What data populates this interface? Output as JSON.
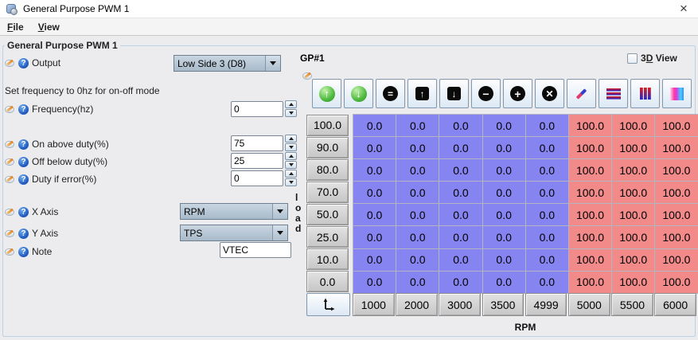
{
  "window": {
    "title": "General Purpose PWM 1",
    "close_glyph": "×"
  },
  "menu": {
    "items": [
      {
        "name": "file",
        "accel": "F",
        "rest": "ile"
      },
      {
        "name": "view",
        "accel": "V",
        "rest": "iew"
      }
    ]
  },
  "group": {
    "title": "General Purpose PWM 1"
  },
  "fields": {
    "output": {
      "label": "Output",
      "value": "Low Side 3 (D8)"
    },
    "hint": "Set frequency to 0hz for on-off mode",
    "frequency": {
      "label": "Frequency(hz)",
      "value": "0"
    },
    "on_above_duty": {
      "label": "On above duty(%)",
      "value": "75"
    },
    "off_below_duty": {
      "label": "Off below duty(%)",
      "value": "25"
    },
    "duty_if_error": {
      "label": "Duty if error(%)",
      "value": "0"
    },
    "x_axis": {
      "label": "X Axis",
      "value": "RPM"
    },
    "y_axis": {
      "label": "Y Axis",
      "value": "TPS"
    },
    "note": {
      "label": "Note",
      "value": "VTEC"
    }
  },
  "table": {
    "title": "GP#1",
    "view3d": {
      "prefix": "3",
      "accel": "D",
      "suffix": " View",
      "checked": false
    },
    "y_axis_label": "load",
    "x_axis_label": "RPM",
    "row_headers": [
      "100.0",
      "90.0",
      "80.0",
      "70.0",
      "50.0",
      "25.0",
      "10.0",
      "0.0"
    ],
    "col_headers": [
      "1000",
      "2000",
      "3000",
      "3500",
      "4999",
      "5000",
      "5500",
      "6000"
    ],
    "grid": [
      [
        "0.0",
        "0.0",
        "0.0",
        "0.0",
        "0.0",
        "100.0",
        "100.0",
        "100.0"
      ],
      [
        "0.0",
        "0.0",
        "0.0",
        "0.0",
        "0.0",
        "100.0",
        "100.0",
        "100.0"
      ],
      [
        "0.0",
        "0.0",
        "0.0",
        "0.0",
        "0.0",
        "100.0",
        "100.0",
        "100.0"
      ],
      [
        "0.0",
        "0.0",
        "0.0",
        "0.0",
        "0.0",
        "100.0",
        "100.0",
        "100.0"
      ],
      [
        "0.0",
        "0.0",
        "0.0",
        "0.0",
        "0.0",
        "100.0",
        "100.0",
        "100.0"
      ],
      [
        "0.0",
        "0.0",
        "0.0",
        "0.0",
        "0.0",
        "100.0",
        "100.0",
        "100.0"
      ],
      [
        "0.0",
        "0.0",
        "0.0",
        "0.0",
        "0.0",
        "100.0",
        "100.0",
        "100.0"
      ],
      [
        "0.0",
        "0.0",
        "0.0",
        "0.0",
        "0.0",
        "100.0",
        "100.0",
        "100.0"
      ]
    ],
    "cell_colors": {
      "low": "#8684f0",
      "high": "#f28a8a"
    },
    "low_high_threshold": 50
  },
  "toolbar": {
    "buttons": [
      {
        "name": "increase-green",
        "icon": "green-up",
        "glyph": "↑"
      },
      {
        "name": "decrease-green",
        "icon": "green-down",
        "glyph": "↓"
      },
      {
        "name": "set-equal",
        "icon": "circle-equal",
        "glyph": "="
      },
      {
        "name": "shift-up",
        "icon": "square-up",
        "glyph": "↑"
      },
      {
        "name": "shift-down",
        "icon": "square-down",
        "glyph": "↓"
      },
      {
        "name": "decrement",
        "icon": "circle-minus",
        "glyph": "−"
      },
      {
        "name": "increment",
        "icon": "circle-plus",
        "glyph": "+"
      },
      {
        "name": "clear",
        "icon": "circle-x",
        "glyph": "✕"
      },
      {
        "name": "edit-pencil",
        "icon": "pencil",
        "glyph": ""
      },
      {
        "name": "interpolate-rows",
        "icon": "h-bars",
        "glyph": ""
      },
      {
        "name": "interpolate-columns",
        "icon": "v-bars",
        "glyph": ""
      },
      {
        "name": "gradient-colors",
        "icon": "gradient",
        "glyph": ""
      }
    ]
  }
}
